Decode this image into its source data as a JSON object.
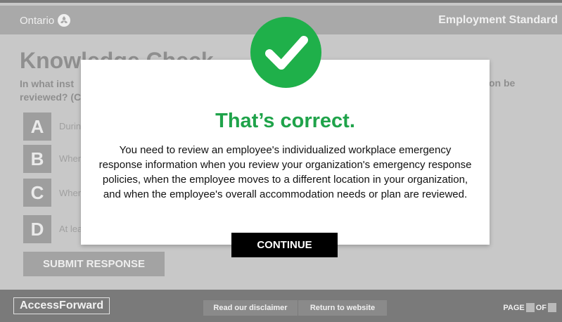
{
  "header": {
    "brand": "Ontario",
    "course_title": "Employment Standard"
  },
  "main": {
    "title": "Knowledge Check",
    "question_line1": "In what inst",
    "question_line2": "reviewed? (C",
    "question_tail": "on be",
    "options": [
      {
        "letter": "A",
        "text": "Durin"
      },
      {
        "letter": "B",
        "text": "When"
      },
      {
        "letter": "C",
        "text": "When"
      },
      {
        "letter": "D",
        "text": "At lea"
      }
    ],
    "submit_label": "SUBMIT RESPONSE"
  },
  "modal": {
    "icon": "checkmark-icon",
    "title": "That’s correct.",
    "body": "You need to review an employee's individualized workplace emergency response information when you review your organization's emergency response policies, when the employee moves to a different location in your organization, and when the employee's overall accommodation needs or plan are reviewed.",
    "continue_label": "CONTINUE",
    "accent_color": "#1fb04a"
  },
  "footer": {
    "logo": "AccessForward",
    "disclaimer_label": "Read our disclaimer",
    "website_label": "Return to website",
    "page_label": "PAGE",
    "of_label": "OF"
  }
}
